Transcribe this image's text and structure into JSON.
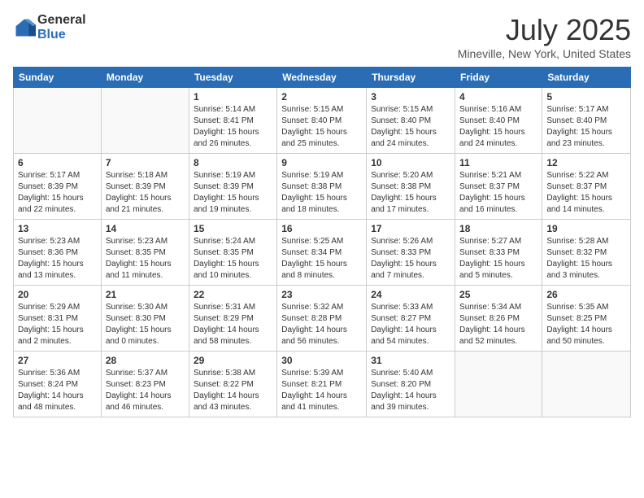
{
  "logo": {
    "general": "General",
    "blue": "Blue"
  },
  "title": "July 2025",
  "subtitle": "Mineville, New York, United States",
  "headers": [
    "Sunday",
    "Monday",
    "Tuesday",
    "Wednesday",
    "Thursday",
    "Friday",
    "Saturday"
  ],
  "weeks": [
    [
      {
        "day": "",
        "info": ""
      },
      {
        "day": "",
        "info": ""
      },
      {
        "day": "1",
        "info": "Sunrise: 5:14 AM\nSunset: 8:41 PM\nDaylight: 15 hours and 26 minutes."
      },
      {
        "day": "2",
        "info": "Sunrise: 5:15 AM\nSunset: 8:40 PM\nDaylight: 15 hours and 25 minutes."
      },
      {
        "day": "3",
        "info": "Sunrise: 5:15 AM\nSunset: 8:40 PM\nDaylight: 15 hours and 24 minutes."
      },
      {
        "day": "4",
        "info": "Sunrise: 5:16 AM\nSunset: 8:40 PM\nDaylight: 15 hours and 24 minutes."
      },
      {
        "day": "5",
        "info": "Sunrise: 5:17 AM\nSunset: 8:40 PM\nDaylight: 15 hours and 23 minutes."
      }
    ],
    [
      {
        "day": "6",
        "info": "Sunrise: 5:17 AM\nSunset: 8:39 PM\nDaylight: 15 hours and 22 minutes."
      },
      {
        "day": "7",
        "info": "Sunrise: 5:18 AM\nSunset: 8:39 PM\nDaylight: 15 hours and 21 minutes."
      },
      {
        "day": "8",
        "info": "Sunrise: 5:19 AM\nSunset: 8:39 PM\nDaylight: 15 hours and 19 minutes."
      },
      {
        "day": "9",
        "info": "Sunrise: 5:19 AM\nSunset: 8:38 PM\nDaylight: 15 hours and 18 minutes."
      },
      {
        "day": "10",
        "info": "Sunrise: 5:20 AM\nSunset: 8:38 PM\nDaylight: 15 hours and 17 minutes."
      },
      {
        "day": "11",
        "info": "Sunrise: 5:21 AM\nSunset: 8:37 PM\nDaylight: 15 hours and 16 minutes."
      },
      {
        "day": "12",
        "info": "Sunrise: 5:22 AM\nSunset: 8:37 PM\nDaylight: 15 hours and 14 minutes."
      }
    ],
    [
      {
        "day": "13",
        "info": "Sunrise: 5:23 AM\nSunset: 8:36 PM\nDaylight: 15 hours and 13 minutes."
      },
      {
        "day": "14",
        "info": "Sunrise: 5:23 AM\nSunset: 8:35 PM\nDaylight: 15 hours and 11 minutes."
      },
      {
        "day": "15",
        "info": "Sunrise: 5:24 AM\nSunset: 8:35 PM\nDaylight: 15 hours and 10 minutes."
      },
      {
        "day": "16",
        "info": "Sunrise: 5:25 AM\nSunset: 8:34 PM\nDaylight: 15 hours and 8 minutes."
      },
      {
        "day": "17",
        "info": "Sunrise: 5:26 AM\nSunset: 8:33 PM\nDaylight: 15 hours and 7 minutes."
      },
      {
        "day": "18",
        "info": "Sunrise: 5:27 AM\nSunset: 8:33 PM\nDaylight: 15 hours and 5 minutes."
      },
      {
        "day": "19",
        "info": "Sunrise: 5:28 AM\nSunset: 8:32 PM\nDaylight: 15 hours and 3 minutes."
      }
    ],
    [
      {
        "day": "20",
        "info": "Sunrise: 5:29 AM\nSunset: 8:31 PM\nDaylight: 15 hours and 2 minutes."
      },
      {
        "day": "21",
        "info": "Sunrise: 5:30 AM\nSunset: 8:30 PM\nDaylight: 15 hours and 0 minutes."
      },
      {
        "day": "22",
        "info": "Sunrise: 5:31 AM\nSunset: 8:29 PM\nDaylight: 14 hours and 58 minutes."
      },
      {
        "day": "23",
        "info": "Sunrise: 5:32 AM\nSunset: 8:28 PM\nDaylight: 14 hours and 56 minutes."
      },
      {
        "day": "24",
        "info": "Sunrise: 5:33 AM\nSunset: 8:27 PM\nDaylight: 14 hours and 54 minutes."
      },
      {
        "day": "25",
        "info": "Sunrise: 5:34 AM\nSunset: 8:26 PM\nDaylight: 14 hours and 52 minutes."
      },
      {
        "day": "26",
        "info": "Sunrise: 5:35 AM\nSunset: 8:25 PM\nDaylight: 14 hours and 50 minutes."
      }
    ],
    [
      {
        "day": "27",
        "info": "Sunrise: 5:36 AM\nSunset: 8:24 PM\nDaylight: 14 hours and 48 minutes."
      },
      {
        "day": "28",
        "info": "Sunrise: 5:37 AM\nSunset: 8:23 PM\nDaylight: 14 hours and 46 minutes."
      },
      {
        "day": "29",
        "info": "Sunrise: 5:38 AM\nSunset: 8:22 PM\nDaylight: 14 hours and 43 minutes."
      },
      {
        "day": "30",
        "info": "Sunrise: 5:39 AM\nSunset: 8:21 PM\nDaylight: 14 hours and 41 minutes."
      },
      {
        "day": "31",
        "info": "Sunrise: 5:40 AM\nSunset: 8:20 PM\nDaylight: 14 hours and 39 minutes."
      },
      {
        "day": "",
        "info": ""
      },
      {
        "day": "",
        "info": ""
      }
    ]
  ]
}
